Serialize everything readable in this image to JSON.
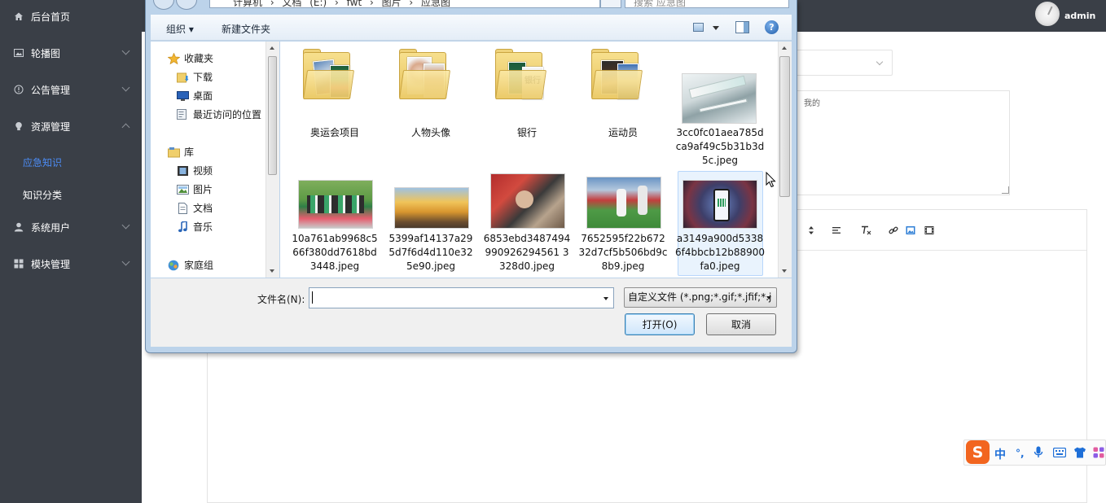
{
  "sidebar": {
    "items": [
      {
        "label": "后台首页",
        "icon": "home-icon"
      },
      {
        "label": "轮播图",
        "icon": "image-icon"
      },
      {
        "label": "公告管理",
        "icon": "notice-icon"
      },
      {
        "label": "资源管理",
        "icon": "bulb-icon"
      },
      {
        "label": "系统用户",
        "icon": "user-icon"
      },
      {
        "label": "模块管理",
        "icon": "grid-icon"
      }
    ],
    "subitems": [
      {
        "label": "应急知识",
        "active": true
      },
      {
        "label": "知识分类",
        "active": false
      }
    ]
  },
  "topbar": {
    "user": "admin"
  },
  "content": {
    "textarea_fragment": "我的"
  },
  "editor": {
    "toolbar_icons": [
      "line-height-icon",
      "align-left-icon",
      "clear-format-icon",
      "link-icon",
      "image-icon",
      "video-icon"
    ]
  },
  "ime": {
    "logo": "S",
    "buttons": [
      "中",
      "°,",
      "🎤",
      "⌨",
      "👕",
      "▦"
    ]
  },
  "dialog": {
    "address_path": "计算机 › 文档 (E:) › fwt › 图片 › 应急图",
    "search_placeholder": "搜索 应急图",
    "toolbar": {
      "organize": "组织 ▾",
      "new_folder": "新建文件夹",
      "help": "?"
    },
    "nav": {
      "favorites": "收藏夹",
      "favorites_items": [
        "下载",
        "桌面",
        "最近访问的位置"
      ],
      "libraries": "库",
      "libraries_items": [
        "视频",
        "图片",
        "文档",
        "音乐"
      ],
      "homegroup": "家庭组"
    },
    "files": [
      {
        "name": "奥运会项目",
        "type": "folder"
      },
      {
        "name": "人物头像",
        "type": "folder"
      },
      {
        "name": "银行",
        "type": "folder"
      },
      {
        "name": "运动员",
        "type": "folder"
      },
      {
        "name": "3cc0fc01aea785dca9af49c5b31b3d5c.jpeg",
        "type": "image"
      },
      {
        "name": "10a761ab9968c566f380dd7618bd3448.jpeg",
        "type": "image"
      },
      {
        "name": "5399af14137a295d7f6d4d110e325e90.jpeg",
        "type": "image"
      },
      {
        "name": "6853ebd3487494990926294561 3328d0.jpeg",
        "type": "image"
      },
      {
        "name": "7652595f22b67232d7cf5b506bd9c8b9.jpeg",
        "type": "image"
      },
      {
        "name": "a3149a900d53386f4bbcb12b88900fa0.jpeg",
        "type": "image"
      }
    ],
    "folder_bank_text": "银行",
    "filename_label": "文件名(N):",
    "filename_value": "",
    "filetype": "自定义文件 (*.png;*.gif;*.jfif;*.j",
    "open_button": "打开(O)",
    "cancel_button": "取消"
  }
}
